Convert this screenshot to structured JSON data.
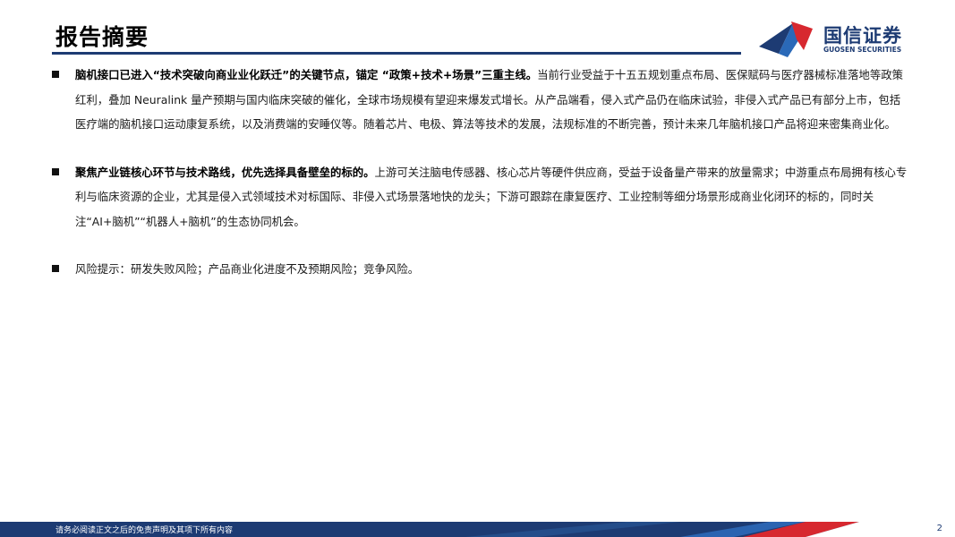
{
  "header": {
    "title": "报告摘要",
    "logo_cn": "国信证券",
    "logo_en": "GUOSEN SECURITIES"
  },
  "paragraphs": [
    {
      "lead": "脑机接口已进入“技术突破向商业业化跃迁”的关键节点，锚定 “政策+技术+场景”三重主线。",
      "body": "当前行业受益于十五五规划重点布局、医保赋码与医疗器械标准落地等政策红利，叠加 Neuralink 量产预期与国内临床突破的催化，全球市场规模有望迎来爆发式增长。从产品端看，侵入式产品仍在临床试验，非侵入式产品已有部分上市，包括医疗端的脑机接口运动康复系统，以及消费端的安睡仪等。随着芯片、电极、算法等技术的发展，法规标准的不断完善，预计未来几年脑机接口产品将迎来密集商业化。"
    },
    {
      "lead": "聚焦产业链核心环节与技术路线，优先选择具备壁垒的标的。",
      "body": "上游可关注脑电传感器、核心芯片等硬件供应商，受益于设备量产带来的放量需求；中游重点布局拥有核心专利与临床资源的企业，尤其是侵入式领域技术对标国际、非侵入式场景落地快的龙头；下游可跟踪在康复医疗、工业控制等细分场景形成商业化闭环的标的，同时关注“AI+脑机”“机器人+脑机”的生态协同机会。"
    },
    {
      "lead": "",
      "body": "风险提示：研发失败风险；产品商业化进度不及预期风险；竞争风险。"
    }
  ],
  "footer": {
    "disclaimer": "请务必阅读正文之后的免责声明及其项下所有内容",
    "page_number": "2"
  },
  "colors": {
    "brand_navy": "#1d3b73",
    "brand_red": "#d7282f",
    "accent_blue": "#2a69b8"
  }
}
